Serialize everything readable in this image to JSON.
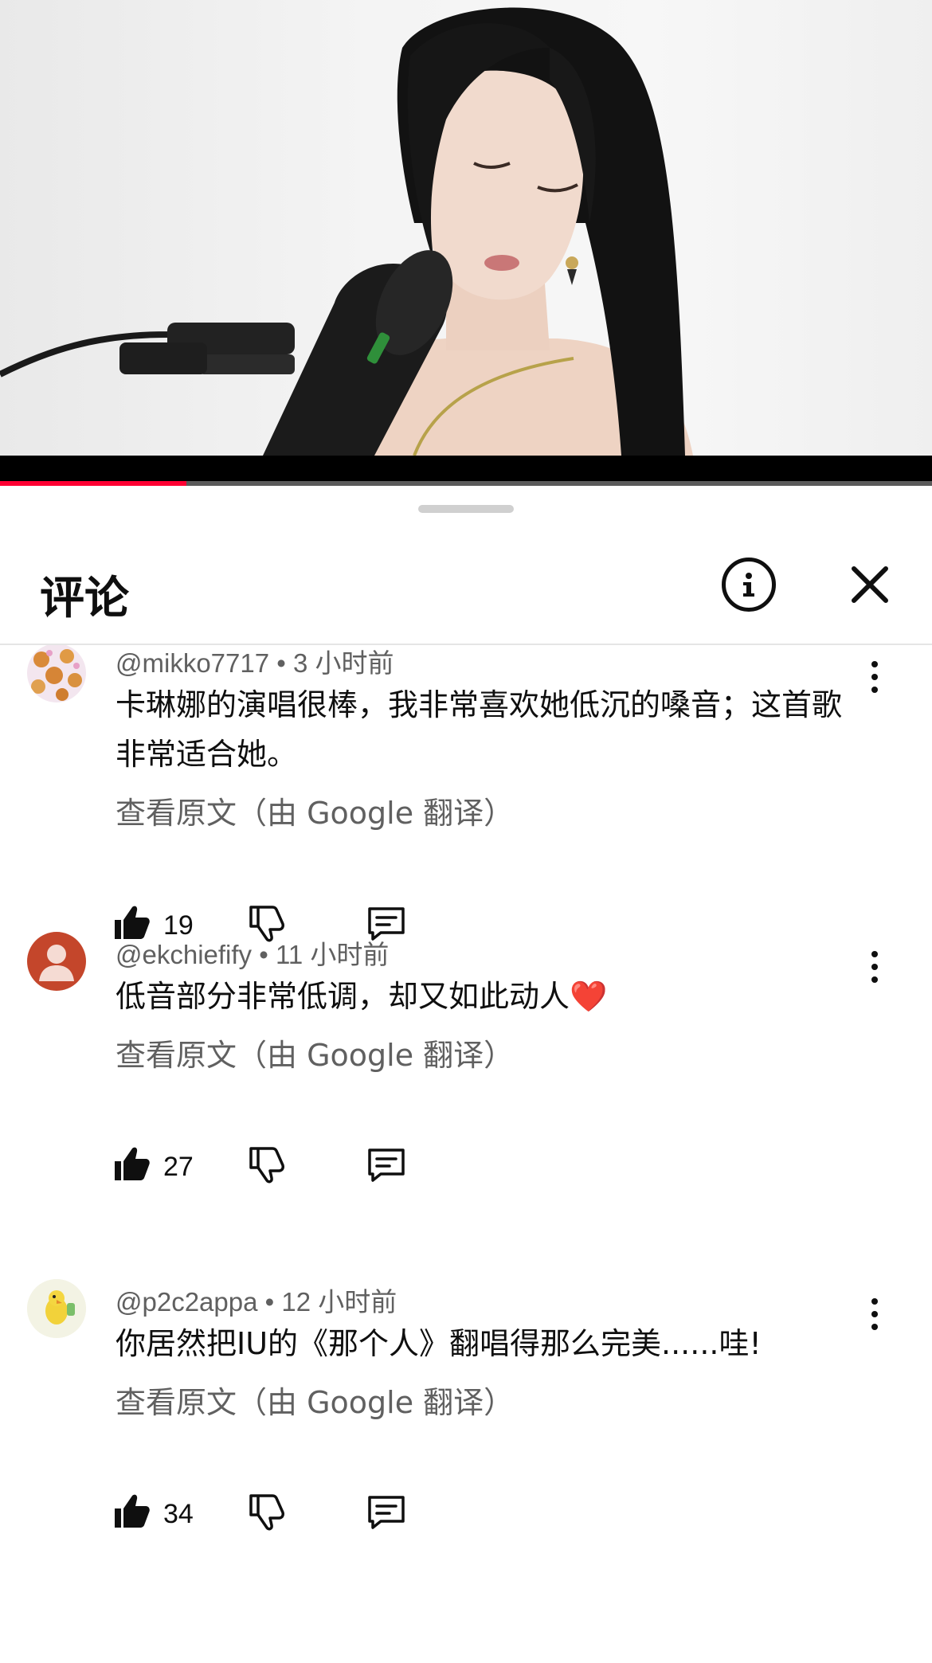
{
  "video": {
    "channel_logo_text": "",
    "progress_fraction": 0.2
  },
  "sheet": {
    "title": "评论",
    "info_icon": "info-icon",
    "close_icon": "close-icon"
  },
  "comments": [
    {
      "handle": "@mikko7717",
      "time": "3 小时前",
      "text": "卡琳娜的演唱很棒，我非常喜欢她低沉的嗓音；这首歌非常适合她。",
      "translate_label": "查看原文（由 Google 翻译）",
      "likes": "19",
      "avatar": "patterned-avatar"
    },
    {
      "handle": "@ekchiefify",
      "time": "11 小时前",
      "text": "低音部分非常低调，却又如此动人❤️",
      "translate_label": "查看原文（由 Google 翻译）",
      "likes": "27",
      "avatar": "default-person-avatar"
    },
    {
      "handle": "@p2c2appa",
      "time": "12 小时前",
      "text": "你居然把IU的《那个人》翻唱得那么完美......哇!",
      "translate_label": "查看原文（由 Google 翻译）",
      "likes": "34",
      "avatar": "bird-avatar"
    }
  ],
  "colors": {
    "progress": "#ff0033",
    "meta_text": "#606060",
    "default_avatar_bg": "#c4462b"
  }
}
